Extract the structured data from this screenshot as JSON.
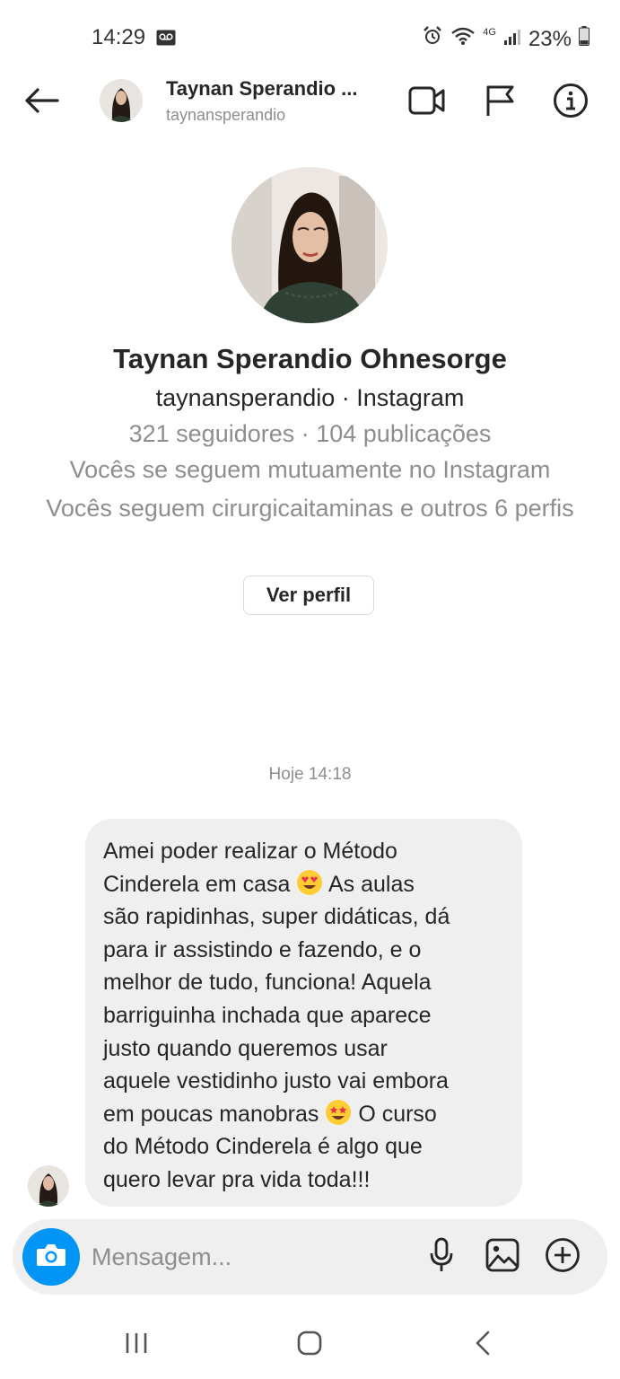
{
  "status_bar": {
    "time": "14:29",
    "network_label": "4G",
    "battery": "23%",
    "icons": [
      "voicemail-icon",
      "alarm-icon",
      "wifi-icon",
      "signal-icon",
      "battery-icon"
    ]
  },
  "header": {
    "name": "Taynan Sperandio ...",
    "username": "taynansperandio",
    "icons": [
      "back-arrow-icon",
      "video-call-icon",
      "flag-icon",
      "info-icon"
    ]
  },
  "profile": {
    "full_name": "Taynan Sperandio Ohnesorge",
    "username_line": "taynansperandio · Instagram",
    "stats": "321 seguidores · 104 publicações",
    "mutual": "Vocês se seguem mutuamente no Instagram",
    "common_follows": "Vocês seguem cirurgicaitaminas e outros 6 perfis",
    "view_profile_label": "Ver perfil"
  },
  "conversation": {
    "date_separator": "Hoje 14:18",
    "message": {
      "lines": [
        "Amei poder realizar o Método",
        "Cinderela em casa",
        "As aulas",
        "são rapidinhas, super didáticas, dá",
        "para ir assistindo e fazendo, e o",
        "melhor de tudo, funciona! Aquela",
        "barriguinha inchada que aparece",
        "justo quando queremos usar",
        "aquele vestidinho justo vai embora",
        "em poucas manobras",
        "O curso",
        "do Método Cinderela é algo que",
        "quero levar pra vida toda!!!"
      ],
      "emojis": [
        "heart-eyes-emoji",
        "star-struck-emoji"
      ]
    }
  },
  "composer": {
    "placeholder": "Mensagem...",
    "icons": [
      "camera-icon",
      "microphone-icon",
      "gallery-icon",
      "add-icon"
    ]
  },
  "navigation": {
    "icons": [
      "recent-apps-icon",
      "home-icon",
      "back-icon"
    ]
  },
  "colors": {
    "accent": "#0095f6",
    "bubble": "#efefef",
    "secondary_text": "#8e8e8e",
    "primary_text": "#262626"
  }
}
